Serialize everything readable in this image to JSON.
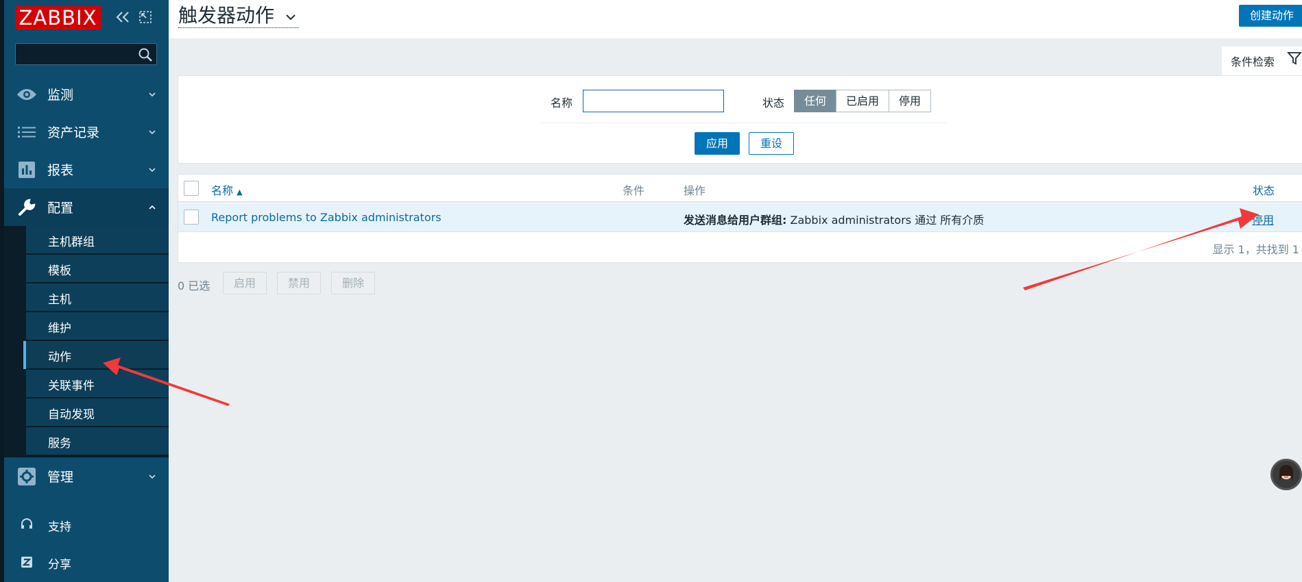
{
  "sidebar": {
    "logo": "ZABBIX",
    "search_placeholder": "",
    "menu": [
      {
        "label": "监测",
        "icon": "eye-icon"
      },
      {
        "label": "资产记录",
        "icon": "list-icon"
      },
      {
        "label": "报表",
        "icon": "bar-chart-icon"
      },
      {
        "label": "配置",
        "icon": "wrench-icon"
      },
      {
        "label": "管理",
        "icon": "gear-icon"
      }
    ],
    "config_submenu": [
      "主机群组",
      "模板",
      "主机",
      "维护",
      "动作",
      "关联事件",
      "自动发现",
      "服务"
    ],
    "active_submenu": "动作",
    "bottom": [
      {
        "label": "支持",
        "icon": "headset-icon"
      },
      {
        "label": "分享",
        "icon": "share-icon"
      }
    ]
  },
  "header": {
    "title": "触发器动作",
    "create_button": "创建动作"
  },
  "filter": {
    "tab_label": "条件检索",
    "name_label": "名称",
    "name_value": "",
    "status_label": "状态",
    "status_options": [
      "任何",
      "已启用",
      "停用"
    ],
    "status_selected": "任何",
    "apply": "应用",
    "reset": "重设"
  },
  "table": {
    "columns": {
      "name": "名称",
      "conditions": "条件",
      "operations": "操作",
      "status": "状态"
    },
    "rows": [
      {
        "name": "Report problems to Zabbix administrators",
        "conditions": "",
        "operation_bold": "发送消息给用户群组:",
        "operation_rest": " Zabbix administrators 通过 所有介质",
        "status": "停用"
      }
    ],
    "footer": "显示 1，共找到 1"
  },
  "mass_actions": {
    "selected": "0 已选",
    "enable": "启用",
    "disable": "禁用",
    "delete": "删除"
  },
  "colors": {
    "sidebar_bg": "#0e4c6e",
    "accent": "#0275b8",
    "logo_red": "#d40000",
    "annotation_arrow": "#f03a3a"
  }
}
